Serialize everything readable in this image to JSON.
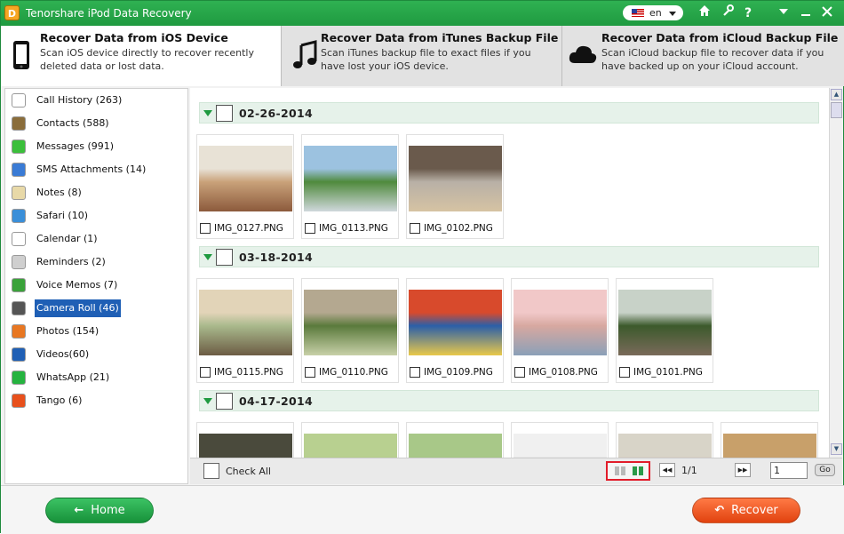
{
  "app": {
    "title": "Tenorshare iPod Data Recovery",
    "logo_letter": "D",
    "language": "en"
  },
  "titlebar_icons": [
    "home-icon",
    "settings-icon",
    "help-icon",
    "menu-icon",
    "minimize-icon",
    "close-icon"
  ],
  "tabs": [
    {
      "title": "Recover Data from iOS Device",
      "desc": "Scan iOS device directly to recover recently deleted data or lost data.",
      "icon": "phone-icon"
    },
    {
      "title": "Recover Data from iTunes Backup File",
      "desc": "Scan iTunes backup file to exact files if you have lost your iOS device.",
      "icon": "music-note-icon"
    },
    {
      "title": "Recover Data from iCloud Backup File",
      "desc": "Scan iCloud backup file to recover data if you have backed up on your iCloud account.",
      "icon": "cloud-icon"
    }
  ],
  "sidebar": {
    "items": [
      {
        "label": "Call History (263)",
        "icon": "call-history-icon",
        "color": "#ffffff"
      },
      {
        "label": "Contacts (588)",
        "icon": "contacts-icon",
        "color": "#8a6d3b"
      },
      {
        "label": "Messages (991)",
        "icon": "messages-icon",
        "color": "#3bbf3b"
      },
      {
        "label": "SMS Attachments (14)",
        "icon": "attachment-icon",
        "color": "#3a7bd5"
      },
      {
        "label": "Notes (8)",
        "icon": "notes-icon",
        "color": "#e8d9a8"
      },
      {
        "label": "Safari (10)",
        "icon": "safari-icon",
        "color": "#3a8fd9"
      },
      {
        "label": "Calendar (1)",
        "icon": "calendar-icon",
        "color": "#ffffff"
      },
      {
        "label": "Reminders (2)",
        "icon": "reminders-icon",
        "color": "#cfcfcf"
      },
      {
        "label": "Voice Memos (7)",
        "icon": "voice-memo-icon",
        "color": "#3aa23a"
      },
      {
        "label": "Camera Roll (46)",
        "icon": "camera-icon",
        "color": "#555555"
      },
      {
        "label": "Photos (154)",
        "icon": "photos-icon",
        "color": "#e87722"
      },
      {
        "label": "Videos(60)",
        "icon": "videos-icon",
        "color": "#1f5fb5"
      },
      {
        "label": "WhatsApp (21)",
        "icon": "whatsapp-icon",
        "color": "#25b33f"
      },
      {
        "label": "Tango (6)",
        "icon": "tango-icon",
        "color": "#e8501c"
      }
    ],
    "selected": "Camera Roll (46)"
  },
  "groups": [
    {
      "date": "02-26-2014",
      "files": [
        "IMG_0127.PNG",
        "IMG_0113.PNG",
        "IMG_0102.PNG"
      ]
    },
    {
      "date": "03-18-2014",
      "files": [
        "IMG_0115.PNG",
        "IMG_0110.PNG",
        "IMG_0109.PNG",
        "IMG_0108.PNG",
        "IMG_0101.PNG"
      ]
    },
    {
      "date": "04-17-2014",
      "files": [
        "",
        "",
        "",
        "",
        "",
        ""
      ]
    }
  ],
  "bottombar": {
    "check_all": "Check All",
    "page_info": "1/1",
    "page_input": "1",
    "go": "Go"
  },
  "footer": {
    "home": "Home",
    "recover": "Recover"
  },
  "colors": {
    "brand_green": "#1f9a40",
    "recover_orange": "#e1420f",
    "selection_blue": "#1f5fb5",
    "highlight_red": "#e21c2a"
  }
}
